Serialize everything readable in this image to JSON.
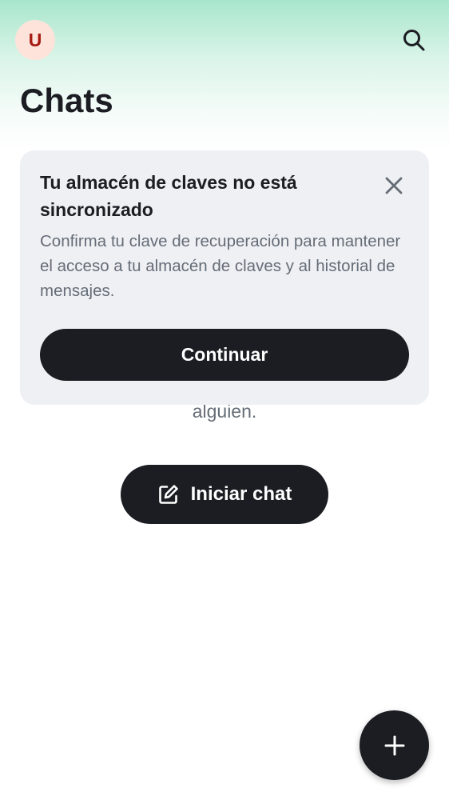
{
  "header": {
    "avatar_initial": "U",
    "title": "Chats",
    "icons": {
      "search": "search-icon"
    }
  },
  "banner": {
    "title": "Tu almacén de claves no está sincronizado",
    "body": "Confirma tu clave de recuperación para mantener el acceso a tu almacén de claves y al historial de mensajes.",
    "continue_label": "Continuar",
    "icons": {
      "close": "close-icon"
    }
  },
  "empty_state": {
    "partial_text": "alguien.",
    "start_chat_label": "Iniciar chat",
    "icons": {
      "compose": "compose-icon"
    }
  },
  "fab": {
    "icon": "plus-icon"
  },
  "colors": {
    "primary": "#1b1d22",
    "secondary_text": "#656d77",
    "banner_background": "#eff0f4",
    "avatar_background": "#fde3da",
    "avatar_text": "#a51b12",
    "header_gradient": "#a8e6cc"
  }
}
